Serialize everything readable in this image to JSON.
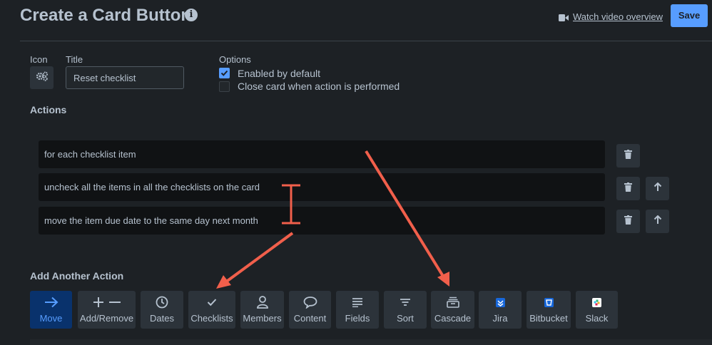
{
  "header": {
    "title": "Create a Card Button",
    "info_icon": "info-icon",
    "video_link_label": "Watch video overview",
    "video_icon": "video-camera-icon",
    "save_label": "Save"
  },
  "form": {
    "icon_label": "Icon",
    "icon_value": "gears-icon",
    "title_label": "Title",
    "title_value": "Reset checklist",
    "options_label": "Options",
    "options": [
      {
        "label": "Enabled by default",
        "checked": true
      },
      {
        "label": "Close card when action is performed",
        "checked": false
      }
    ]
  },
  "actions": {
    "heading": "Actions",
    "items": [
      {
        "text": "for each checklist item"
      },
      {
        "text": "uncheck all the items in all the checklists on the card"
      },
      {
        "text": "move the item due date to the same day next month"
      }
    ]
  },
  "add_action": {
    "heading": "Add Another Action",
    "buttons": [
      {
        "label": "Move",
        "icon": "arrow-right-icon",
        "active": true
      },
      {
        "label": "Add/Remove",
        "icon": "plus-minus-icon",
        "active": false
      },
      {
        "label": "Dates",
        "icon": "clock-icon",
        "active": false
      },
      {
        "label": "Checklists",
        "icon": "checkmark-icon",
        "active": false
      },
      {
        "label": "Members",
        "icon": "person-icon",
        "active": false
      },
      {
        "label": "Content",
        "icon": "speech-bubble-icon",
        "active": false
      },
      {
        "label": "Fields",
        "icon": "lines-icon",
        "active": false
      },
      {
        "label": "Sort",
        "icon": "sort-icon",
        "active": false
      },
      {
        "label": "Cascade",
        "icon": "archive-icon",
        "active": false
      },
      {
        "label": "Jira",
        "icon": "jira-icon",
        "active": false
      },
      {
        "label": "Bitbucket",
        "icon": "bitbucket-icon",
        "active": false
      },
      {
        "label": "Slack",
        "icon": "slack-icon",
        "active": false
      }
    ]
  },
  "colors": {
    "background": "#1d2125",
    "text": "#b6c2cf",
    "accent": "#579dff",
    "active_button": "#09326c",
    "annotation": "#f15f4b"
  }
}
